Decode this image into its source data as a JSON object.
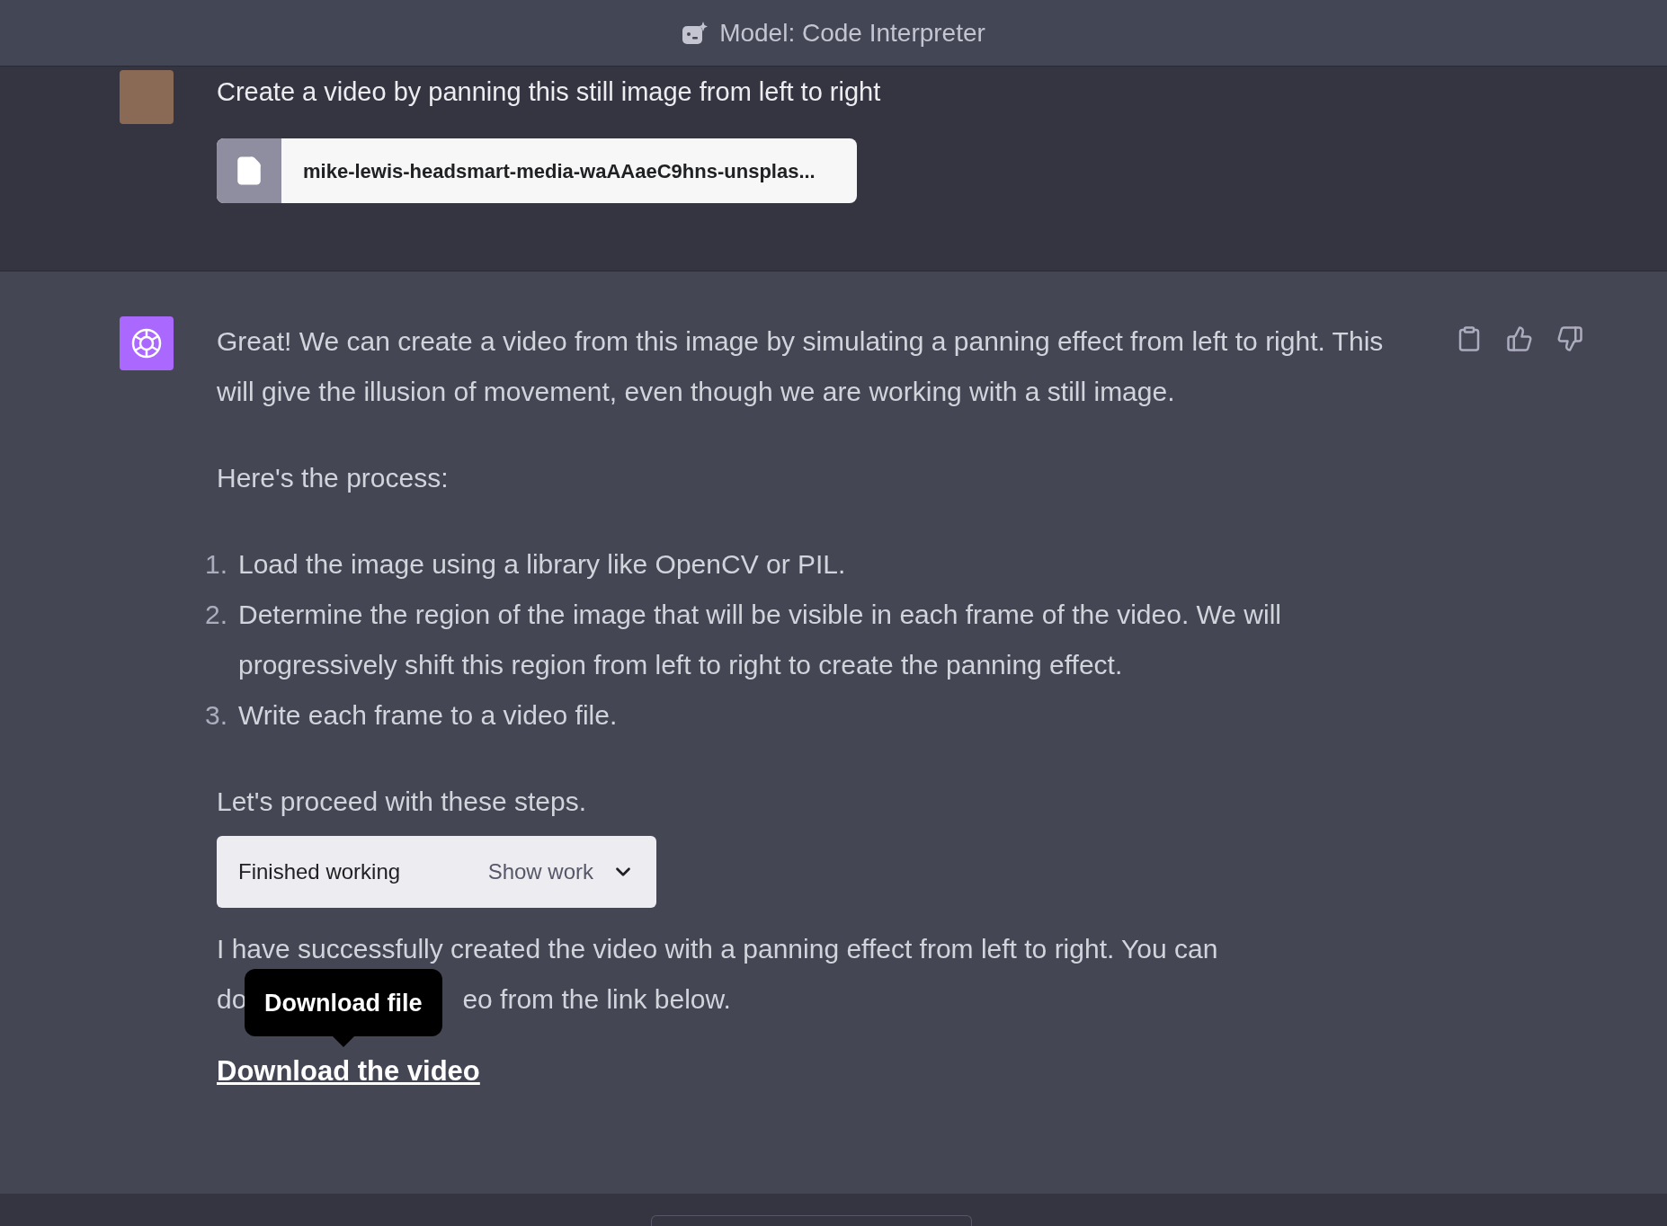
{
  "header": {
    "title": "Model: Code Interpreter"
  },
  "user_message": {
    "text": "Create a video by panning this still image from left to right",
    "attachment": {
      "filename": "mike-lewis-headsmart-media-waAAaeC9hns-unsplas..."
    }
  },
  "assistant_message": {
    "paragraph": "Great! We can create a video from this image by simulating a panning effect from left to right. This will give the illusion of movement, even though we are working with a still image.",
    "intro": "Here's the process:",
    "steps": [
      {
        "number": "1.",
        "text": "Load the image using a library like OpenCV or PIL."
      },
      {
        "number": "2.",
        "text": "Determine the region of the image that will be visible in each frame of the video. We will progressively shift this region from left to right to create the panning effect."
      },
      {
        "number": "3.",
        "text": "Write each frame to a video file."
      }
    ],
    "closing": "Let's proceed with these steps.",
    "work_panel": {
      "status": "Finished working",
      "toggle": "Show work",
      "expanded": false
    },
    "result_line_1": "I have successfully created the video with a panning effect from left to right. You can",
    "result_line_2_start": "do",
    "result_line_2_end": "eo from the link below.",
    "tooltip": "Download file",
    "link": "Download the video"
  }
}
